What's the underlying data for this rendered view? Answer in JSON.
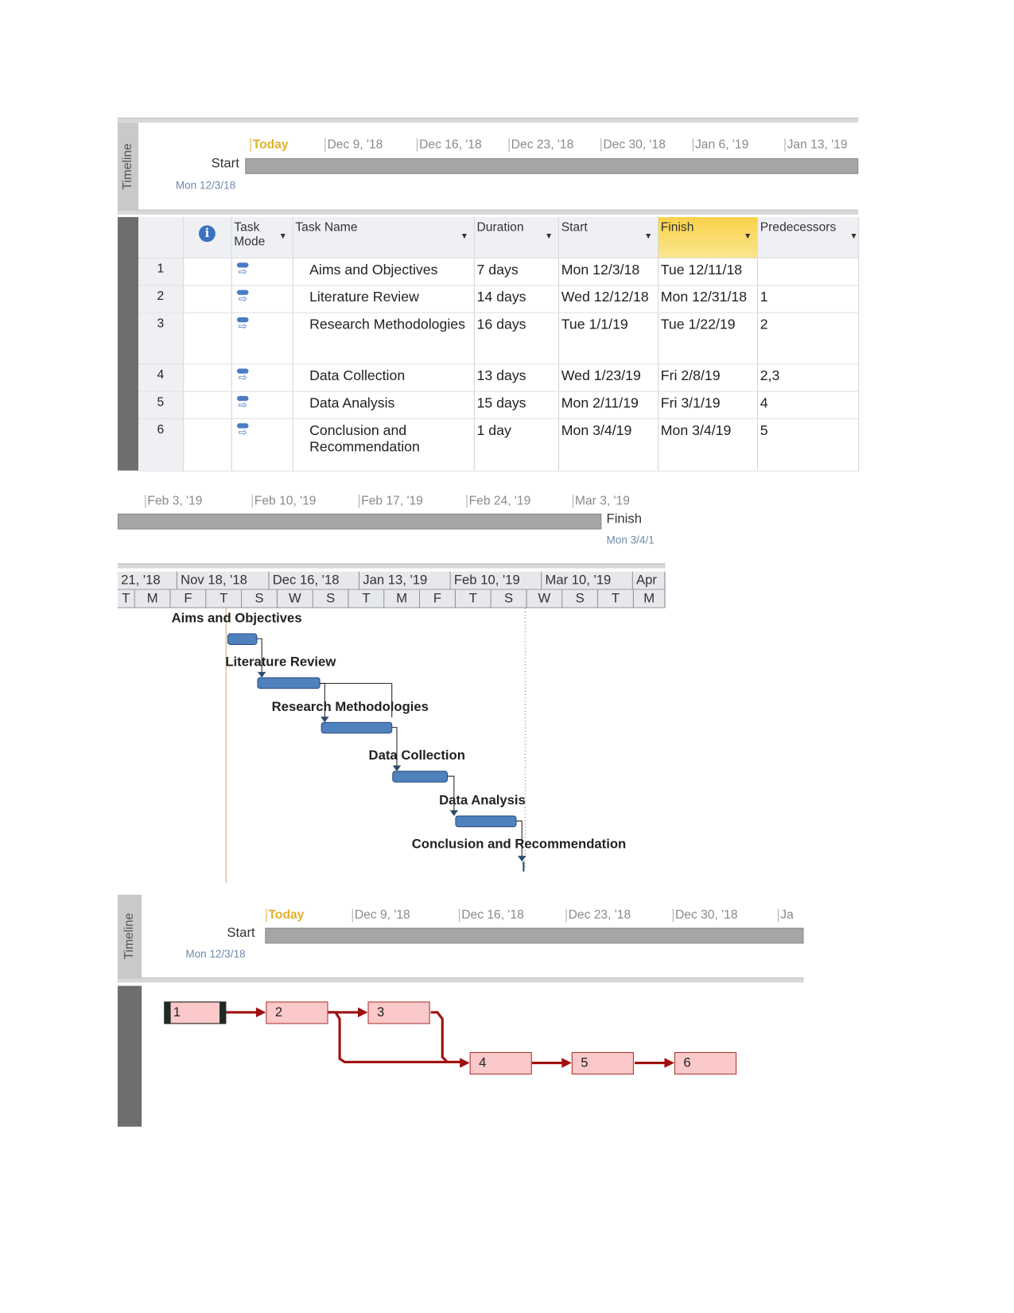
{
  "timeline_top": {
    "label": "Timeline",
    "today": "Today",
    "ticks": [
      "Dec 9, '18",
      "Dec 16, '18",
      "Dec 23, '18",
      "Dec 30, '18",
      "Jan 6, '19",
      "Jan 13, '19"
    ],
    "start_label": "Start",
    "start_date": "Mon 12/3/18"
  },
  "table": {
    "headers": {
      "mode": "Task Mode",
      "name": "Task Name",
      "duration": "Duration",
      "start": "Start",
      "finish": "Finish",
      "predecessors": "Predecessors",
      "info_icon": "i"
    },
    "rows": [
      {
        "id": "1",
        "name": "Aims and Objectives",
        "duration": "7 days",
        "start": "Mon 12/3/18",
        "finish": "Tue 12/11/18",
        "pred": ""
      },
      {
        "id": "2",
        "name": "Literature Review",
        "duration": "14 days",
        "start": "Wed 12/12/18",
        "finish": "Mon 12/31/18",
        "pred": "1"
      },
      {
        "id": "3",
        "name": "Research Methodologies",
        "duration": "16 days",
        "start": "Tue 1/1/19",
        "finish": "Tue 1/22/19",
        "pred": "2"
      },
      {
        "id": "4",
        "name": "Data Collection",
        "duration": "13 days",
        "start": "Wed 1/23/19",
        "finish": "Fri 2/8/19",
        "pred": "2,3"
      },
      {
        "id": "5",
        "name": "Data Analysis",
        "duration": "15 days",
        "start": "Mon 2/11/19",
        "finish": "Fri 3/1/19",
        "pred": "4"
      },
      {
        "id": "6",
        "name": "Conclusion and Recommendation",
        "duration": "1 day",
        "start": "Mon 3/4/19",
        "finish": "Mon 3/4/19",
        "pred": "5"
      }
    ]
  },
  "timeline_mid": {
    "ticks": [
      "Feb 3, '19",
      "Feb 10, '19",
      "Feb 17, '19",
      "Feb 24, '19",
      "Mar 3, '19"
    ],
    "finish_label": "Finish",
    "finish_date": "Mon 3/4/1"
  },
  "gantt": {
    "months": [
      "21, '18",
      "Nov 18, '18",
      "Dec 16, '18",
      "Jan 13, '19",
      "Feb 10, '19",
      "Mar 10, '19",
      "Apr"
    ],
    "days": [
      "T",
      "M",
      "F",
      "T",
      "S",
      "W",
      "S",
      "T",
      "M",
      "F",
      "T",
      "S",
      "W",
      "S",
      "T",
      "M"
    ],
    "tasks": [
      "Aims and Objectives",
      "Literature Review",
      "Research Methodologies",
      "Data Collection",
      "Data Analysis",
      "Conclusion and Recommendation"
    ],
    "bar_color": "#4f81bd"
  },
  "timeline_bottom": {
    "label": "Timeline",
    "today": "Today",
    "ticks": [
      "Dec 9, '18",
      "Dec 16, '18",
      "Dec 23, '18",
      "Dec 30, '18",
      "Ja"
    ],
    "start_label": "Start",
    "start_date": "Mon 12/3/18"
  },
  "network": {
    "nodes": [
      "1",
      "2",
      "3",
      "4",
      "5",
      "6"
    ],
    "node_fill": "#fbc9c9",
    "link_color": "#a01010"
  }
}
